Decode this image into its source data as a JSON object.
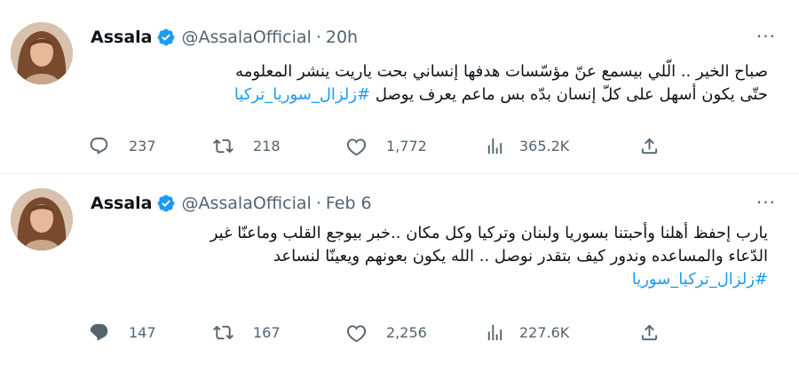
{
  "tweets": [
    {
      "author": "Assala",
      "handle": "@AssalaOfficial",
      "separator": "·",
      "time": "20h",
      "more": "···",
      "lines": [
        "صباح الخير .. الّلي بيسمع عنّ مؤسّسات هدفها إنساني بحت ياريت ينشر المعلومه",
        "حتّى يكون أسهل على كلّ إنسان بدّه بس ماعم يعرف يوصل"
      ],
      "hashtag": "#زلزال_سوريا_تركيا",
      "replies": "237",
      "retweets": "218",
      "likes": "1,772",
      "views": "365.2K"
    },
    {
      "author": "Assala",
      "handle": "@AssalaOfficial",
      "separator": "·",
      "time": "Feb 6",
      "more": "···",
      "lines": [
        "يارب إحفظ أهلنا وأحبتنا بسوريا ولبنان وتركيا وكل مكان ..خبر بيوجع القلب وماعنّا غير",
        "الدّعاء والمساعده وندور كيف بتقدر نوصل .. الله يكون بعونهم ويعينّا لنساعد"
      ],
      "hashtag": "#زلزال_تركيا_سوريا",
      "replies": "147",
      "retweets": "167",
      "likes": "2,256",
      "views": "227.6K"
    }
  ],
  "colors": {
    "text": "#0f1419",
    "secondary": "#536471",
    "accent": "#1d9bf0",
    "divider": "#eff3f4"
  },
  "icons": [
    "reply-icon",
    "retweet-icon",
    "like-icon",
    "views-icon",
    "share-icon",
    "verified-badge-icon",
    "more-icon"
  ]
}
